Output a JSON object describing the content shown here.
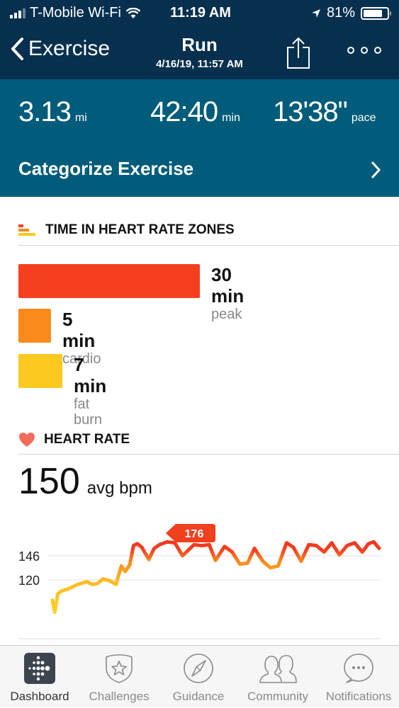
{
  "status_bar": {
    "carrier": "T-Mobile Wi-Fi",
    "time": "11:19 AM",
    "battery": "81%",
    "battery_level": 0.81,
    "signal_bars": 3,
    "signal_bars_total": 4
  },
  "nav": {
    "back_label": "Exercise",
    "title": "Run",
    "subtitle": "4/16/19, 11:57 AM",
    "share_icon": "share-icon",
    "more_icon": "more-dots-icon"
  },
  "stats": {
    "distance": {
      "value": "3.13",
      "unit": "mi"
    },
    "duration": {
      "value": "42:40",
      "unit": "min"
    },
    "pace": {
      "value": "13'38\"",
      "unit": "pace"
    },
    "categorize_label": "Categorize Exercise"
  },
  "zones": {
    "title": "TIME IN HEART RATE ZONES",
    "items": [
      {
        "value": "30 min",
        "label": "peak",
        "minutes": 30,
        "color": "#f5401f"
      },
      {
        "value": "5 min",
        "label": "cardio",
        "minutes": 5,
        "color": "#fb8a1d"
      },
      {
        "value": "7 min",
        "label": "fat burn",
        "minutes": 7,
        "color": "#fdc820"
      }
    ]
  },
  "heart_rate": {
    "title": "HEART RATE",
    "avg_value": "150",
    "avg_label": "avg bpm",
    "peak_label": "176"
  },
  "chart_data": {
    "type": "line",
    "title": "HEART RATE",
    "xlabel": "",
    "ylabel": "bpm",
    "y_ticks": [
      120,
      146
    ],
    "ylim": [
      75,
      185
    ],
    "grid": true,
    "annotation": {
      "label": "176",
      "x": 18.5,
      "y": 176
    },
    "x": [
      0,
      0.3,
      0.7,
      1.2,
      2,
      3.3,
      4.5,
      5.2,
      5.9,
      6.6,
      7.5,
      8.3,
      9,
      9.5,
      10.1,
      10.6,
      11.1,
      11.7,
      12.6,
      13.3,
      14,
      15,
      16,
      17,
      18.5,
      19.5,
      20.5,
      21.3,
      22.5,
      23.5,
      24.5,
      25.5,
      26.4,
      27.5,
      28.5,
      29.5,
      30.6,
      31.5,
      32.5,
      33.5,
      34.5,
      35.5,
      36.5,
      37.5,
      38.5,
      39.5,
      40.5,
      41.3,
      42,
      42.7
    ],
    "y": [
      98,
      85,
      105,
      108,
      110,
      115,
      118,
      115,
      116,
      121,
      119,
      115,
      135,
      129,
      136,
      157,
      159,
      155,
      142,
      154,
      158,
      161,
      160,
      146,
      158,
      157,
      158,
      141,
      156,
      150,
      137,
      138,
      154,
      140,
      133,
      135,
      160,
      155,
      140,
      158,
      157,
      150,
      160,
      147,
      157,
      160,
      150,
      159,
      161,
      154
    ]
  },
  "tabbar": {
    "items": [
      {
        "label": "Dashboard",
        "icon": "dashboard-icon",
        "active": true
      },
      {
        "label": "Challenges",
        "icon": "challenges-star-badge-icon",
        "active": false
      },
      {
        "label": "Guidance",
        "icon": "compass-icon",
        "active": false
      },
      {
        "label": "Community",
        "icon": "people-icon",
        "active": false
      },
      {
        "label": "Notifications",
        "icon": "chat-bubble-icon",
        "active": false
      }
    ]
  }
}
